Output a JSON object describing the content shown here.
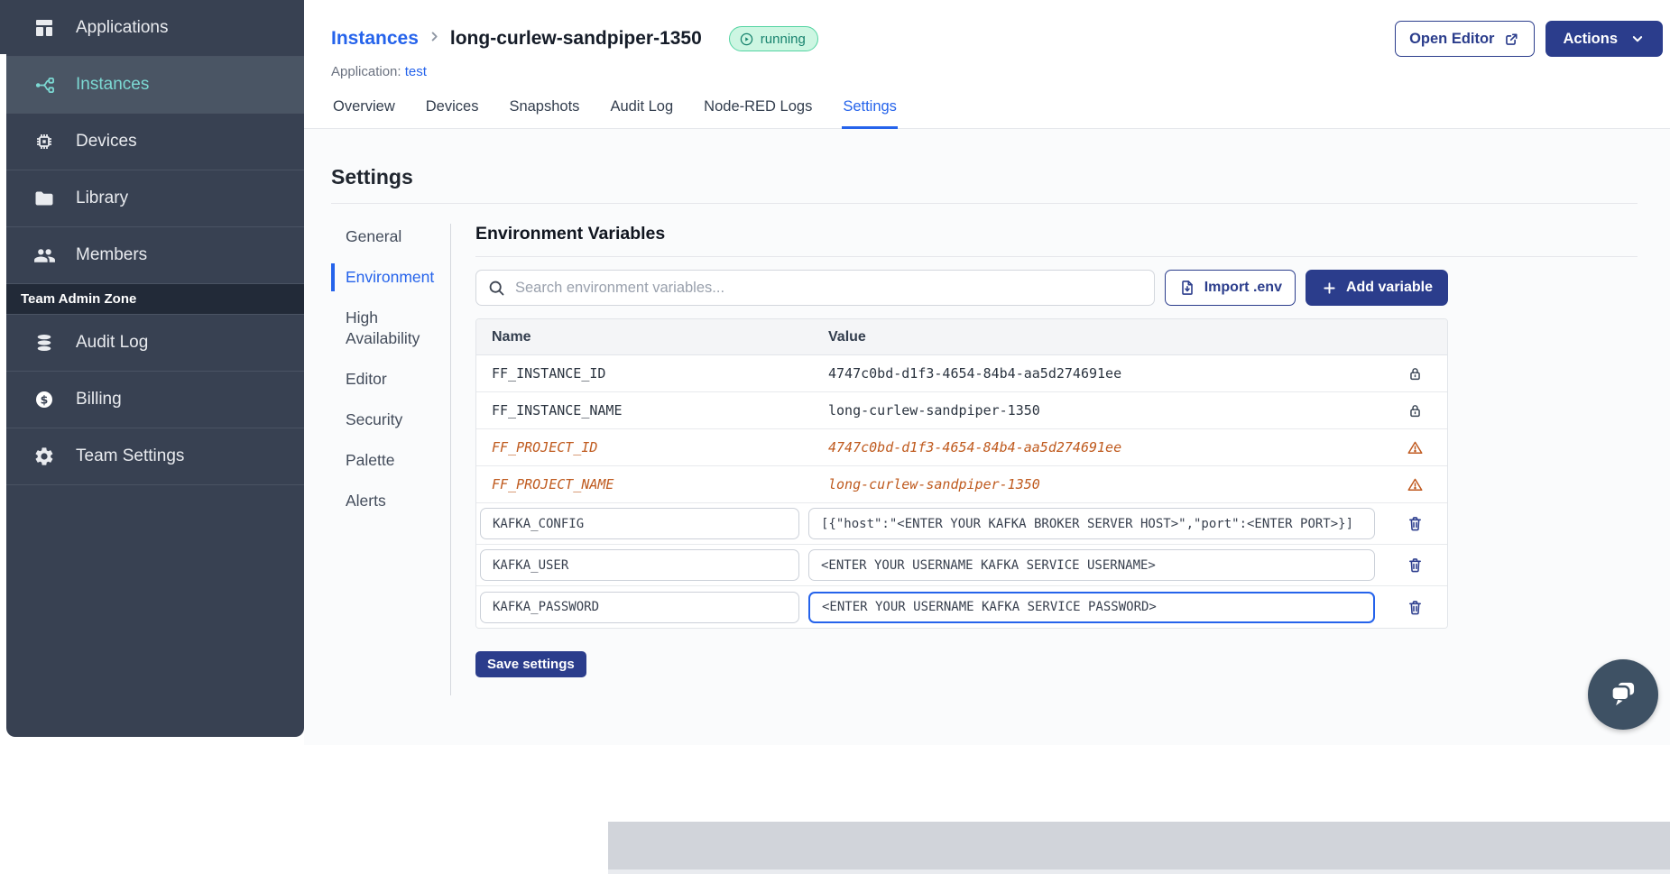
{
  "sidebar": {
    "items": [
      {
        "label": "Applications"
      },
      {
        "label": "Instances"
      },
      {
        "label": "Devices"
      },
      {
        "label": "Library"
      },
      {
        "label": "Members"
      }
    ],
    "section_label": "Team Admin Zone",
    "admin_items": [
      {
        "label": "Audit Log"
      },
      {
        "label": "Billing"
      },
      {
        "label": "Team Settings"
      }
    ],
    "active_item": "Instances",
    "active_color": "#7cd9d3",
    "bg_color": "#384152"
  },
  "header": {
    "breadcrumb_parent": "Instances",
    "instance_name": "long-curlew-sandpiper-1350",
    "status": "running",
    "application_label": "Application:",
    "application_name": "test",
    "open_editor_label": "Open Editor",
    "actions_label": "Actions"
  },
  "tabs": [
    "Overview",
    "Devices",
    "Snapshots",
    "Audit Log",
    "Node-RED Logs",
    "Settings"
  ],
  "active_tab": "Settings",
  "settings": {
    "title": "Settings",
    "nav": [
      "General",
      "Environment",
      "High Availability",
      "Editor",
      "Security",
      "Palette",
      "Alerts"
    ],
    "active_nav": "Environment"
  },
  "env": {
    "title": "Environment Variables",
    "search_placeholder": "Search environment variables...",
    "import_label": "Import .env",
    "add_label": "Add variable",
    "save_label": "Save settings",
    "columns": {
      "name": "Name",
      "value": "Value"
    },
    "rows": [
      {
        "name": "FF_INSTANCE_ID",
        "value": "4747c0bd-d1f3-4654-84b4-aa5d274691ee",
        "type": "locked"
      },
      {
        "name": "FF_INSTANCE_NAME",
        "value": "long-curlew-sandpiper-1350",
        "type": "locked"
      },
      {
        "name": "FF_PROJECT_ID",
        "value": "4747c0bd-d1f3-4654-84b4-aa5d274691ee",
        "type": "deprecated"
      },
      {
        "name": "FF_PROJECT_NAME",
        "value": "long-curlew-sandpiper-1350",
        "type": "deprecated"
      },
      {
        "name": "KAFKA_CONFIG",
        "value": "[{\"host\":\"<ENTER YOUR KAFKA BROKER SERVER HOST>\",\"port\":<ENTER PORT>}]",
        "type": "editable"
      },
      {
        "name": "KAFKA_USER",
        "value": "<ENTER YOUR USERNAME KAFKA SERVICE USERNAME>",
        "type": "editable"
      },
      {
        "name": "KAFKA_PASSWORD",
        "value": "<ENTER YOUR USERNAME KAFKA SERVICE PASSWORD>",
        "type": "editable",
        "focused": true
      }
    ]
  },
  "colors": {
    "accent_navy": "#2b3d8c",
    "link_blue": "#2563eb",
    "status_green_bg": "#cdf6e2",
    "status_green_text": "#18836e",
    "deprecated_orange": "#bf5a1e",
    "sidebar_bg": "#384152",
    "footer_band": "#d1d4da"
  }
}
